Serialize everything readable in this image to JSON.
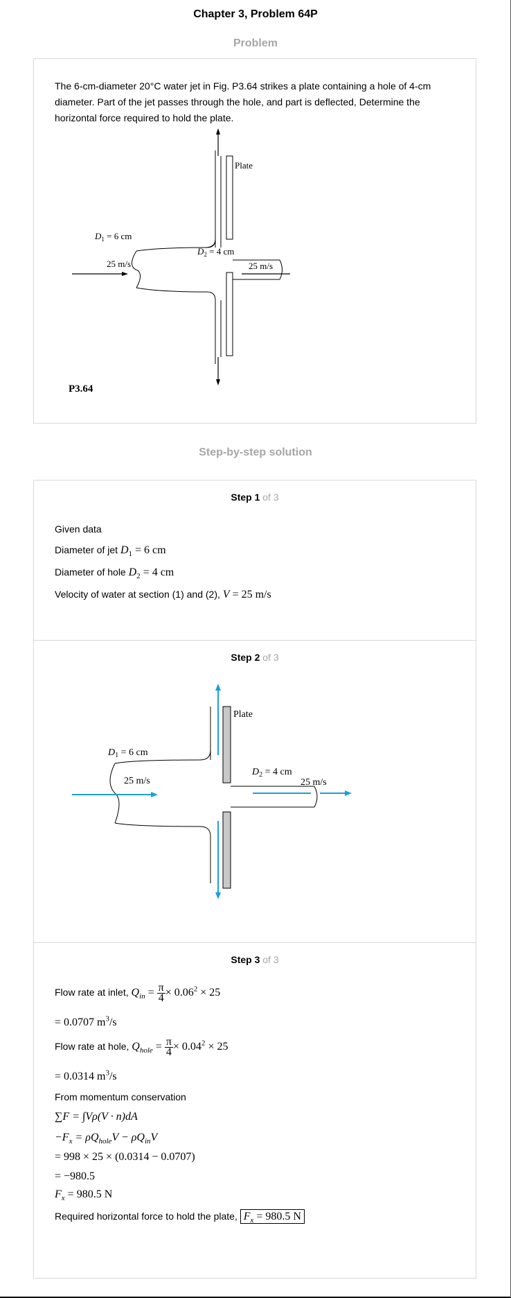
{
  "header": {
    "title": "Chapter 3, Problem 64P"
  },
  "problem": {
    "section_title": "Problem",
    "text": "The 6-cm-diameter 20°C water jet in Fig. P3.64 strikes a plate containing a hole of 4-cm diameter. Part of the jet passes through the hole, and part is deflected, Determine the horizontal force required to hold the plate.",
    "figure": {
      "label_plate": "Plate",
      "label_d1": "D",
      "label_d1_sub": "1",
      "label_d1_val": " = 6 cm",
      "label_d2": "D",
      "label_d2_sub": "2",
      "label_d2_val": " = 4 cm",
      "label_v_in": "25 m/s",
      "label_v_out": "25 m/s",
      "caption": "P3.64"
    }
  },
  "solution": {
    "section_title": "Step-by-step solution",
    "steps": [
      {
        "label": "Step 1",
        "of": " of 3",
        "lines": {
          "given": "Given data",
          "jet_label": "Diameter of jet",
          "jet_sym": "D",
          "jet_sub": "1",
          "jet_val": " = 6 cm",
          "hole_label": "Diameter of hole",
          "hole_sym": "D",
          "hole_sub": "2",
          "hole_val": " = 4 cm",
          "vel_label": "Velocity of water at section (1) and (2),",
          "vel_sym": "V",
          "vel_val": " = 25 m/s"
        }
      },
      {
        "label": "Step 2",
        "of": " of 3",
        "figure": {
          "label_plate": "Plate",
          "label_d1": "D",
          "label_d1_sub": "1",
          "label_d1_val": " = 6 cm",
          "label_d2": "D",
          "label_d2_sub": "2",
          "label_d2_val": " = 4 cm",
          "label_v_in": "25 m/s",
          "label_v_out": "25 m/s",
          "arrow_color": "#1a9fd9"
        }
      },
      {
        "label": "Step 3",
        "of": " of 3",
        "lines": {
          "inlet_label": "Flow rate at inlet,",
          "inlet_lhs": "Q",
          "inlet_sub": "in",
          "inlet_eq": " = ",
          "pi": "π",
          "four": "4",
          "inlet_rhs": "× 0.06",
          "inlet_sq": "2",
          "inlet_rhs2": " × 25",
          "inlet_result": "= 0.0707 m",
          "inlet_unit_sup": "3",
          "inlet_unit_rest": "/s",
          "hole_label": "Flow rate at hole,",
          "hole_lhs": "Q",
          "hole_sub": "hole",
          "hole_rhs": "× 0.04",
          "hole_sq": "2",
          "hole_rhs2": " × 25",
          "hole_result": "= 0.0314 m",
          "hole_unit_sup": "3",
          "hole_unit_rest": "/s",
          "momentum_label": "From momentum conservation",
          "eq1": "∑F = ∫Vρ(V · n)dA",
          "eq2_a": "−F",
          "eq2_a_sub": "x",
          "eq2_b": " = ρQ",
          "eq2_b_sub": "hole",
          "eq2_c": "V − ρQ",
          "eq2_c_sub": "in",
          "eq2_d": "V",
          "eq3": "= 998 × 25 × (0.0314 − 0.0707)",
          "eq4": "= −980.5",
          "eq5_a": "F",
          "eq5_sub": "x",
          "eq5_b": " = 980.5 N",
          "final_label": "Required horizontal force to hold the plate,",
          "final_a": "F",
          "final_sub": "x",
          "final_b": " = 980.5 N"
        }
      }
    ]
  }
}
